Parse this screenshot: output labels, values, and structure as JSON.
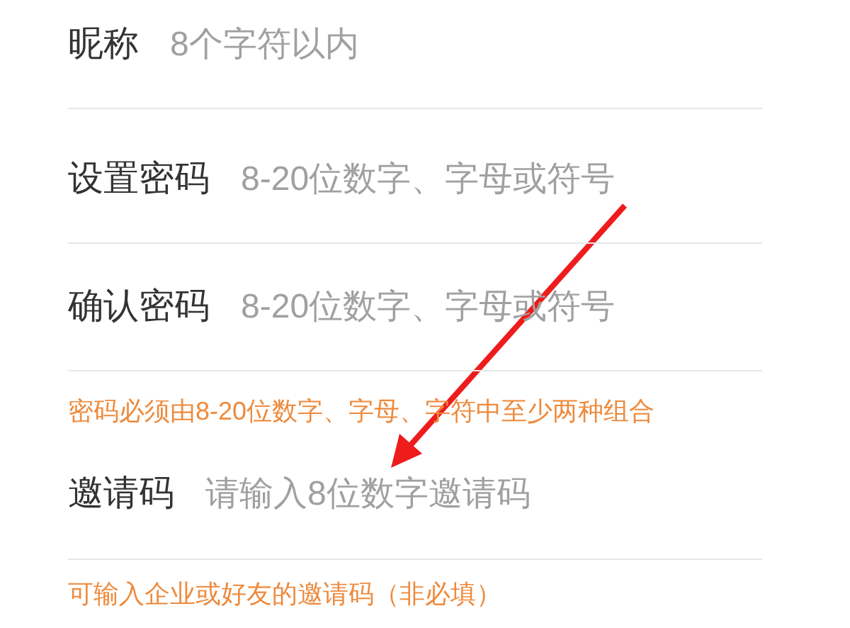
{
  "form": [
    {
      "kind": "field",
      "label": "昵称",
      "placeholder": "8个字符以内"
    },
    {
      "kind": "field",
      "label": "设置密码",
      "placeholder": "8-20位数字、字母或符号"
    },
    {
      "kind": "field",
      "label": "确认密码",
      "placeholder": "8-20位数字、字母或符号"
    },
    {
      "kind": "hint",
      "text": "密码必须由8-20位数字、字母、字符中至少两种组合"
    },
    {
      "kind": "field",
      "label": "邀请码",
      "placeholder": "请输入8位数字邀请码"
    },
    {
      "kind": "hint",
      "text": "可输入企业或好友的邀请码（非必填）"
    }
  ]
}
